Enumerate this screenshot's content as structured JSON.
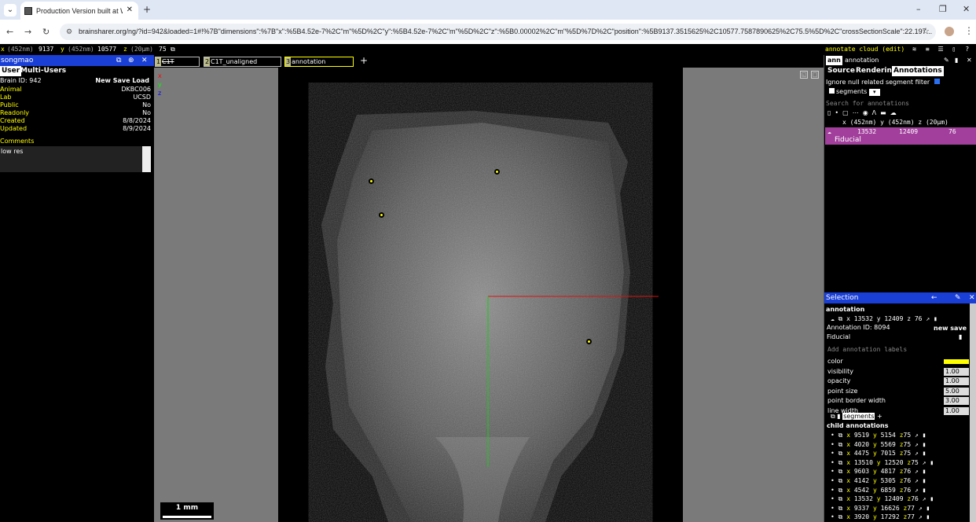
{
  "browser": {
    "tab_title": "Production Version built at We",
    "url": "brainsharer.org/ng/?id=942&loaded=1#!%7B\"dimensions\":%7B\"x\":%5B4.52e-7%2C\"m\"%5D%2C\"y\":%5B4.52e-7%2C\"m\"%5D%2C\"z\":%5B0.00002%2C\"m\"%5D%7D%2C\"position\":%5B9137.3515625%2C10577.7587890625%2C75.5%5D%2C\"crossSectionScale\":22.197..."
  },
  "coords_bar": {
    "x_label": "x",
    "x_unit": "(452nm)",
    "x_val": "9137",
    "y_label": "y",
    "y_unit": "(452nm)",
    "y_val": "10577",
    "z_label": "z",
    "z_unit": "(20µm)",
    "z_val": "75",
    "right_text": "annotate cloud (edit)"
  },
  "user_panel": {
    "username": "songmao",
    "tab_user": "User",
    "tab_multi": "Multi-Users",
    "brain_id": "Brain ID: 942",
    "actions": "New Save Load",
    "fields": [
      {
        "k": "Animal",
        "v": "DKBC006"
      },
      {
        "k": "Lab",
        "v": "UCSD"
      },
      {
        "k": "Public",
        "v": "No"
      },
      {
        "k": "Readonly",
        "v": "No"
      },
      {
        "k": "Created",
        "v": "8/8/2024"
      },
      {
        "k": "Updated",
        "v": "8/9/2024"
      }
    ],
    "comments_label": "Comments",
    "comments_value": "low res"
  },
  "layers": [
    {
      "num": "1",
      "name": "C1T"
    },
    {
      "num": "2",
      "name": "C1T_unaligned"
    },
    {
      "num": "3",
      "name": "annotation"
    }
  ],
  "viewer": {
    "scale_label": "1 mm"
  },
  "annotation_panel": {
    "ann_btn": "ann",
    "layer_name": "annotation",
    "tab_source": "Source",
    "tab_rendering": "Rendering",
    "tab_annotations": "Annotations",
    "ignore_null": "Ignore null related segment filter",
    "segments": "segments",
    "search_placeholder": "Search for annotations",
    "header_coords": "x (452nm)  y (452nm)  z (20µm)",
    "row": {
      "x": "13532",
      "y": "12409",
      "z": "76",
      "type": "Fiducial"
    }
  },
  "selection_panel": {
    "title": "Selection",
    "layer": "annotation",
    "coords": "x 13532  y 12409  z 76",
    "annotation_id": "Annotation ID: 8094",
    "new_save": "new save",
    "type": "Fiducial",
    "labels_placeholder": "Add annotation labels",
    "props": [
      {
        "k": "color",
        "v": ""
      },
      {
        "k": "visibility",
        "v": "1.00"
      },
      {
        "k": "opacity",
        "v": "1.00"
      },
      {
        "k": "point size",
        "v": "5.00"
      },
      {
        "k": "point border width",
        "v": "3.00"
      },
      {
        "k": "line width",
        "v": "1.00"
      }
    ],
    "segments_label": "segments",
    "child_label": "child annotations",
    "children": [
      {
        "x": "9519",
        "y": "5154",
        "z": "75"
      },
      {
        "x": "4020",
        "y": "5569",
        "z": "75"
      },
      {
        "x": "4475",
        "y": "7015",
        "z": "75"
      },
      {
        "x": "13510",
        "y": "12520",
        "z": "75"
      },
      {
        "x": "9603",
        "y": "4817",
        "z": "76"
      },
      {
        "x": "4142",
        "y": "5305",
        "z": "76"
      },
      {
        "x": "4542",
        "y": "6859",
        "z": "76"
      },
      {
        "x": "13532",
        "y": "12409",
        "z": "76"
      },
      {
        "x": "9337",
        "y": "16626",
        "z": "77"
      },
      {
        "x": "3920",
        "y": "17292",
        "z": "77"
      }
    ]
  },
  "colors": {
    "panel_header": "#1a3fd6",
    "annotation_row": "#a23f9c",
    "point": "#ffff00"
  }
}
